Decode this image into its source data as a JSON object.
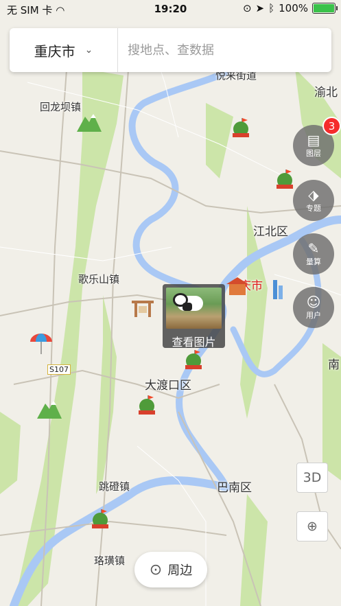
{
  "status_bar": {
    "carrier": "无 SIM 卡",
    "time": "19:20",
    "battery": "100%"
  },
  "search": {
    "city": "重庆市",
    "placeholder": "搜地点、查数据"
  },
  "side_buttons": [
    {
      "label": "图层",
      "icon": "layers-icon"
    },
    {
      "label": "专题",
      "icon": "tag-icon"
    },
    {
      "label": "量算",
      "icon": "ruler-icon"
    },
    {
      "label": "用户",
      "icon": "user-icon"
    }
  ],
  "layer_badge": "3",
  "view_3d_label": "3D",
  "photo_popup": {
    "caption": "查看图片"
  },
  "nearby_label": "周边",
  "map_labels": {
    "huilongba": "回龙坝镇",
    "yubei": "渝北",
    "jiangbei": "江北区",
    "gelesan": "歌乐山镇",
    "chongqing": "庆市",
    "dadukou": "大渡口区",
    "road": "S107",
    "nan": "南",
    "badeng": "跳磴镇",
    "banan": "巴南区",
    "luohuang": "珞璜镇",
    "jiedao": "悦来街道"
  },
  "colors": {
    "river": "#aac8f4",
    "green": "#b9dd92",
    "badge": "#f52c2c",
    "battery": "#3ac24a"
  }
}
